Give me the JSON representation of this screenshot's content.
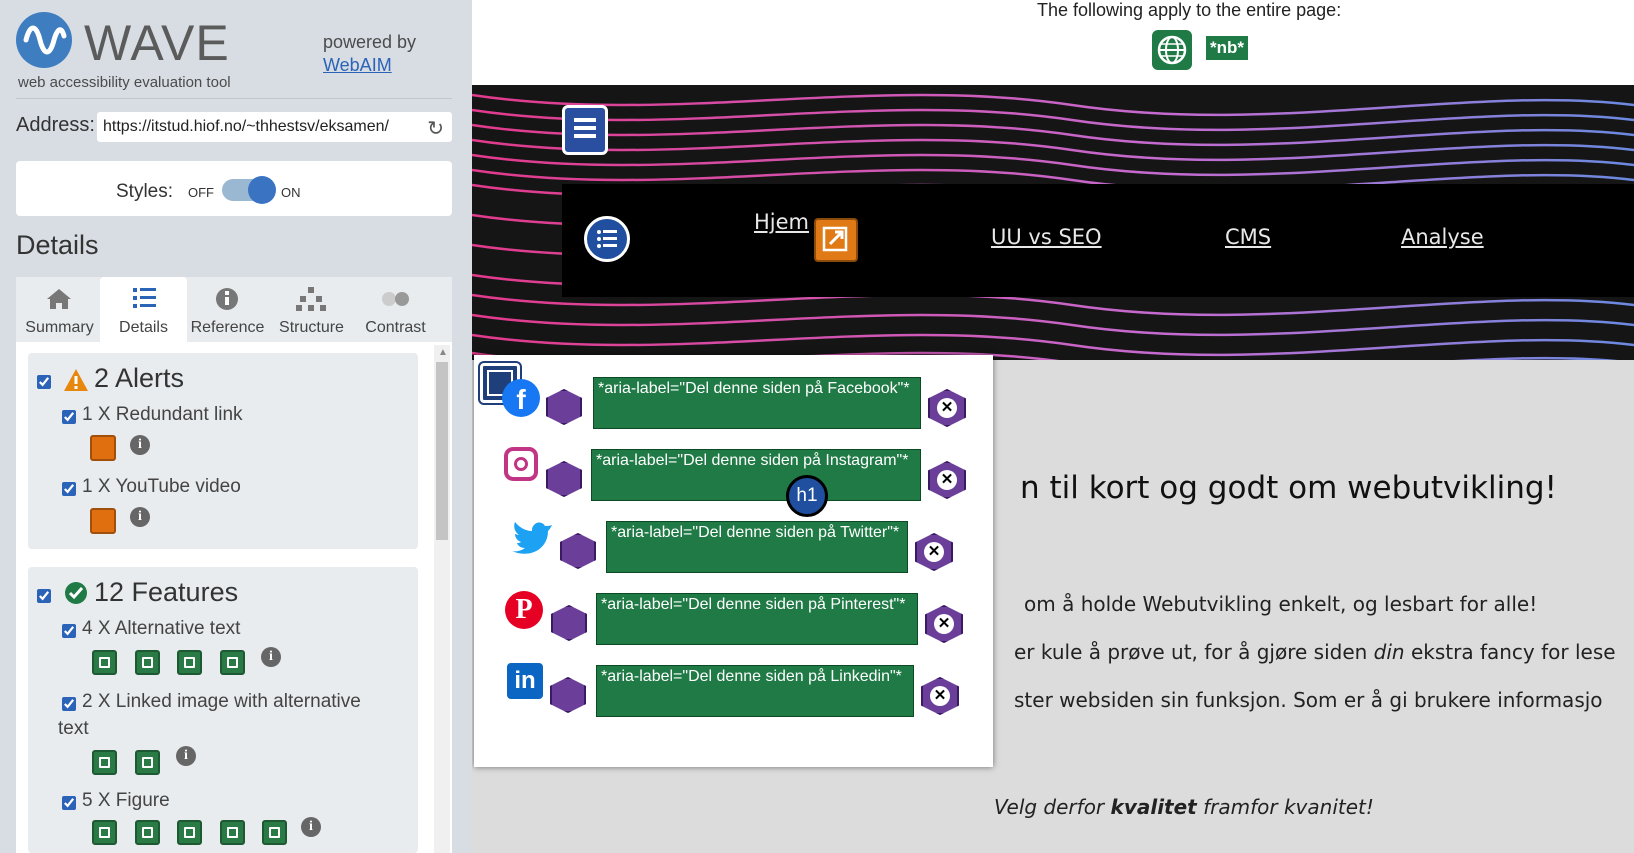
{
  "wave": {
    "logo_text": "WAVE",
    "logo_sub": "web accessibility evaluation tool",
    "powered_by": "powered by",
    "webaim_link": "WebAIM"
  },
  "address": {
    "label": "Address:",
    "value": "https://itstud.hiof.no/~thhestsv/eksamen/"
  },
  "styles": {
    "label": "Styles:",
    "off": "OFF",
    "on": "ON",
    "state": "on"
  },
  "details_heading": "Details",
  "tabs": [
    {
      "label": "Summary",
      "icon": "home-icon"
    },
    {
      "label": "Details",
      "icon": "list-icon",
      "active": true
    },
    {
      "label": "Reference",
      "icon": "info-icon"
    },
    {
      "label": "Structure",
      "icon": "hierarchy-icon"
    },
    {
      "label": "Contrast",
      "icon": "contrast-icon"
    }
  ],
  "alerts": {
    "title": "2 Alerts",
    "items": [
      {
        "label": "1 X Redundant link",
        "count": 1
      },
      {
        "label": "1 X YouTube video",
        "count": 1
      }
    ]
  },
  "features": {
    "title": "12 Features",
    "items": [
      {
        "label": "4 X Alternative text",
        "count": 4
      },
      {
        "label": "2 X Linked image with alternative",
        "label2": "text",
        "count": 2
      },
      {
        "label": "5 X Figure",
        "count": 5
      }
    ]
  },
  "page": {
    "apply_text": "The following apply to the entire page:",
    "lang_badge": "*nb*",
    "nav": [
      "Hjem",
      "UU vs SEO",
      "CMS",
      "Analyse"
    ],
    "heading": "n til kort og godt om webutvikling!",
    "para1": "om å holde Webutvikling enkelt, og lesbart for alle!",
    "para2_a": "er kule å prøve ut, for å gjøre siden ",
    "para2_em": "din",
    "para2_b": " ekstra fancy for lese",
    "para3": "ster websiden sin funksjon. Som er å gi brukere informasjo",
    "quote_a": "Velg derfor ",
    "quote_b": "kvalitet",
    "quote_c": " framfor kvanitet!",
    "h1_badge": "h1"
  },
  "share": [
    {
      "icon": "facebook-icon",
      "aria": "*aria-label=\"Del denne siden på Facebook\"*",
      "color": "#1877f2"
    },
    {
      "icon": "instagram-icon",
      "aria": "*aria-label=\"Del denne siden på Instagram\"*",
      "color": "#c13584"
    },
    {
      "icon": "twitter-icon",
      "aria": "*aria-label=\"Del denne siden på Twitter\"*",
      "color": "#1da1f2"
    },
    {
      "icon": "pinterest-icon",
      "aria": "*aria-label=\"Del denne siden på Pinterest\"*",
      "color": "#e60023"
    },
    {
      "icon": "linkedin-icon",
      "aria": "*aria-label=\"Del denne siden på Linkedin\"*",
      "color": "#0a66c2"
    }
  ],
  "colors": {
    "wave_blue": "#3f7dc1",
    "feature_green": "#1f7a45",
    "alert_orange": "#e06f10",
    "aria_purple": "#6b3e99"
  }
}
